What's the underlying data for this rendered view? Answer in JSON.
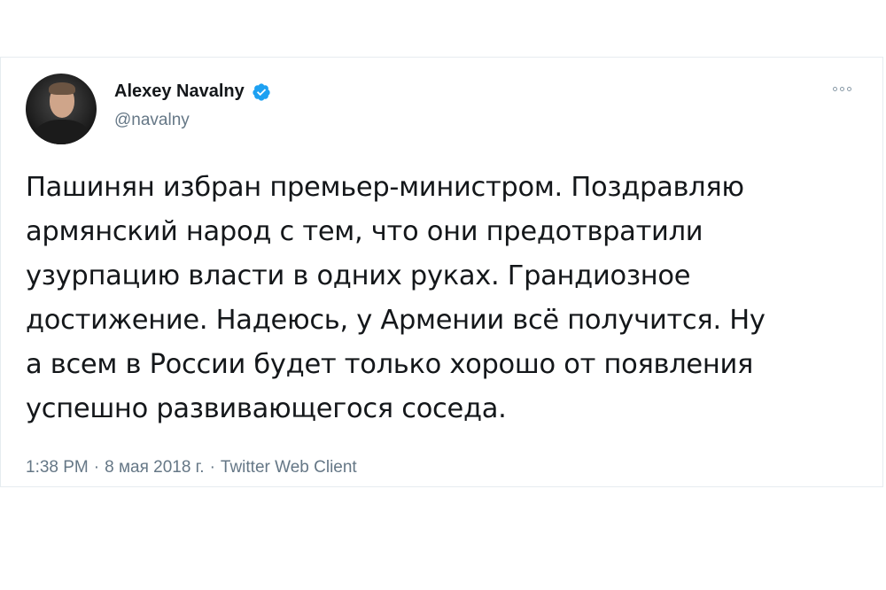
{
  "tweet": {
    "author": {
      "display_name": "Alexey Navalny",
      "handle": "@navalny",
      "verified": true
    },
    "text_lines": [
      "Пашинян избран премьер-министром. Поздравляю",
      "армянский народ с тем, что они предотвратили",
      "узурпацию власти в одних руках. Грандиозное",
      "достижение. Надеюсь, у Армении всё получится. Ну",
      "а всем в России будет только хорошо от появления",
      "успешно развивающегося соседа."
    ],
    "meta": {
      "time": "1:38 PM",
      "separator": "·",
      "date": "8 мая 2018 г.",
      "source": "Twitter Web Client"
    }
  },
  "colors": {
    "verified_badge": "#1da1f2",
    "text": "#14171a",
    "secondary_text": "#657786",
    "border": "#e6ecf0"
  },
  "icons": {
    "verified": "verified-badge-icon",
    "more": "more-options-icon"
  }
}
